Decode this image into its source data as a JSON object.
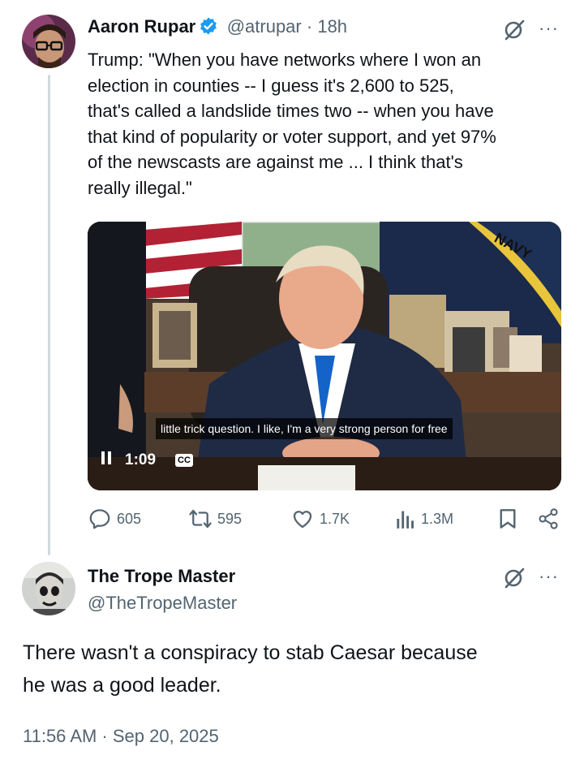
{
  "tweet": {
    "author_name": "Aaron Rupar",
    "handle": "@atrupar",
    "separator": "·",
    "time": "18h",
    "text": "Trump: \"When you have networks where I won an\nelection in counties -- I guess it's 2,600 to 525,\nthat's called a landslide times two -- when you have\nthat kind of popularity or voter support, and yet 97%\nof the newscasts are against me ... I think that's\nreally illegal.\"",
    "video": {
      "caption": "little trick question. I like, I'm a very strong person for free",
      "time": "1:09",
      "cc_label": "CC",
      "flag_text": "NAVY"
    },
    "stats": {
      "replies": "605",
      "reposts": "595",
      "likes": "1.7K",
      "views": "1.3M"
    },
    "more_icon": "···"
  },
  "reply": {
    "author_name": "The Trope Master",
    "handle": "@TheTropeMaster",
    "text": "There wasn't a conspiracy to stab Caesar because\nhe was a good leader.",
    "timestamp": "11:56 AM · Sep 20, 2025",
    "more_icon": "···"
  },
  "colors": {
    "text": "#0f1419",
    "muted": "#536471",
    "verified": "#1d9bf0",
    "thread_line": "#cfd9de"
  }
}
